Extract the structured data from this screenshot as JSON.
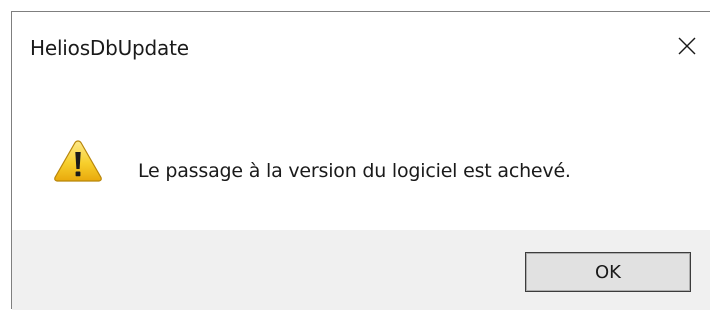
{
  "window": {
    "title": "HeliosDbUpdate"
  },
  "message": {
    "text": "Le passage à la version du logiciel est achevé.",
    "icon": "warning-icon"
  },
  "buttons": {
    "ok_label": "OK"
  },
  "colors": {
    "footer_bg": "#f0f0f0",
    "warning_yellow": "#f5c518"
  }
}
